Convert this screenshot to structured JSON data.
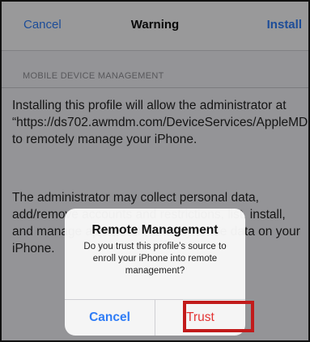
{
  "navbar": {
    "cancel_label": "Cancel",
    "title": "Warning",
    "install_label": "Install"
  },
  "section": {
    "header": "MOBILE DEVICE MANAGEMENT"
  },
  "content": {
    "paragraph1": "Installing this profile will allow the administrator at “https://ds702.awmdm.com/DeviceServices/AppleMDM/Processor.aspx” to remotely manage your iPhone.",
    "paragraph2": "The administrator may collect personal data, add/remove accounts and restrictions, list, install, and manage apps, and remotely erase data on your iPhone."
  },
  "alert": {
    "title": "Remote Management",
    "message": "Do you trust this profile’s source to enroll your iPhone into remote management?",
    "cancel_label": "Cancel",
    "trust_label": "Trust"
  },
  "colors": {
    "accent": "#2f7cf6",
    "destructive": "#e33333",
    "highlight": "#c21b1b"
  }
}
